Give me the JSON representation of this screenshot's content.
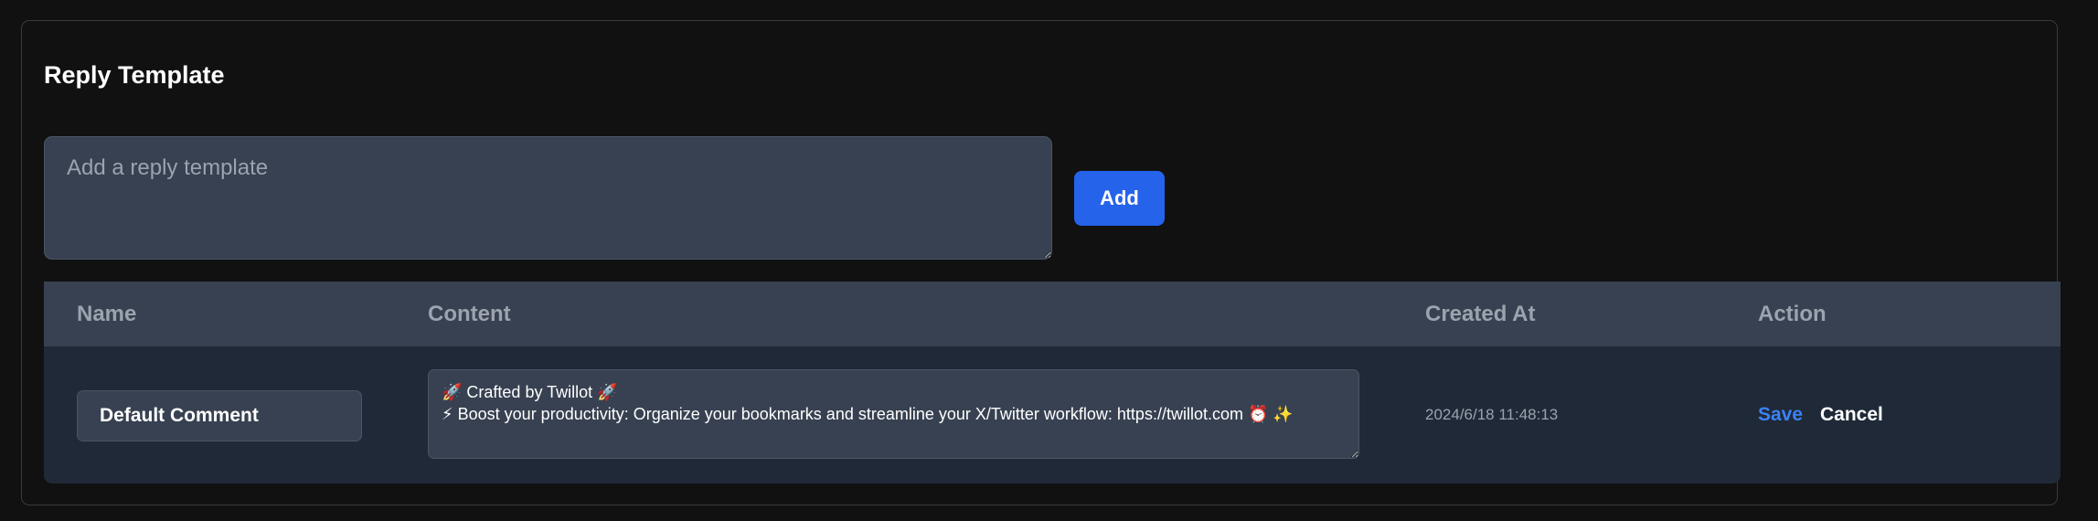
{
  "section": {
    "title": "Reply Template"
  },
  "new_template": {
    "placeholder": "Add a reply template",
    "value": "",
    "add_label": "Add"
  },
  "table": {
    "columns": [
      "Name",
      "Content",
      "Created At",
      "Action"
    ],
    "rows": [
      {
        "name": "Default Comment",
        "content": "🚀 Crafted by Twillot 🚀\n⚡ Boost your productivity: Organize your bookmarks and streamline your X/Twitter workflow: https://twillot.com ⏰ ✨",
        "created_at": "2024/6/18 11:48:13",
        "save_label": "Save",
        "cancel_label": "Cancel"
      }
    ]
  },
  "colors": {
    "background": "#111111",
    "accent": "#2563eb",
    "link": "#3b82f6",
    "header_bg": "#374151",
    "row_bg": "#1f2937"
  }
}
